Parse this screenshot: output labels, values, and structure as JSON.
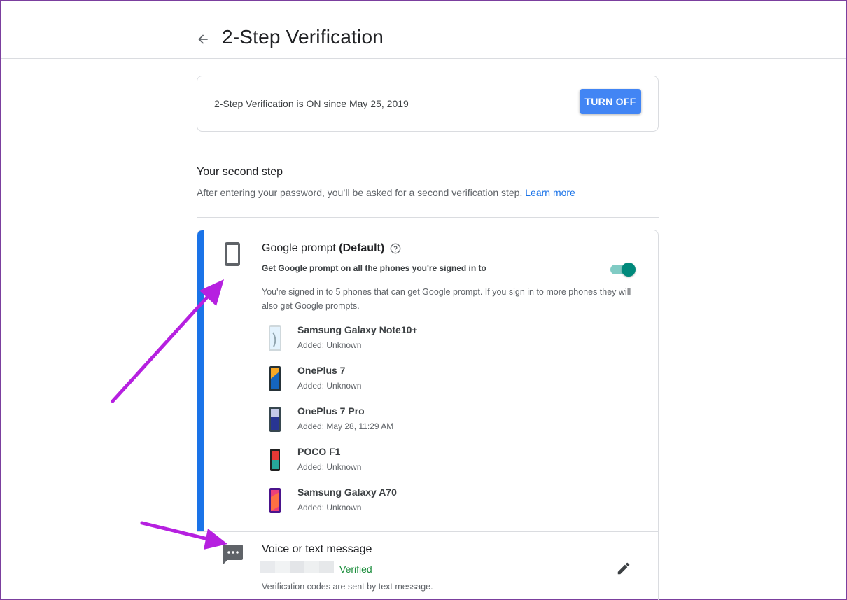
{
  "header": {
    "title": "2-Step Verification",
    "back_icon": "arrow-left-icon"
  },
  "status": {
    "text": "2-Step Verification is ON since May 25, 2019",
    "button_label": "TURN OFF",
    "button_color": "#4285f4"
  },
  "second_step": {
    "title": "Your second step",
    "description": "After entering your password, you’ll be asked for a second verification step.",
    "learn_more": "Learn more"
  },
  "google_prompt": {
    "title_prefix": "Google prompt ",
    "title_default": "(Default)",
    "subtitle": "Get Google prompt on all the phones you're signed in to",
    "toggle_on": true,
    "description": "You're signed in to 5 phones that can get Google prompt. If you sign in to more phones they will also get Google prompts.",
    "accent_color": "#1a73e8",
    "toggle_color": "#00897b",
    "devices": [
      {
        "name": "Samsung Galaxy Note10+",
        "added": "Added: Unknown"
      },
      {
        "name": "OnePlus 7",
        "added": "Added: Unknown"
      },
      {
        "name": "OnePlus 7 Pro",
        "added": "Added: May 28, 11:29 AM"
      },
      {
        "name": "POCO F1",
        "added": "Added: Unknown"
      },
      {
        "name": "Samsung Galaxy A70",
        "added": "Added: Unknown"
      }
    ]
  },
  "voice_text": {
    "title": "Voice or text message",
    "status": "Verified",
    "status_color": "#1e8e3e",
    "description": "Verification codes are sent by text message.",
    "edit_icon": "pencil-icon"
  },
  "annotation_color": "#b620e0"
}
